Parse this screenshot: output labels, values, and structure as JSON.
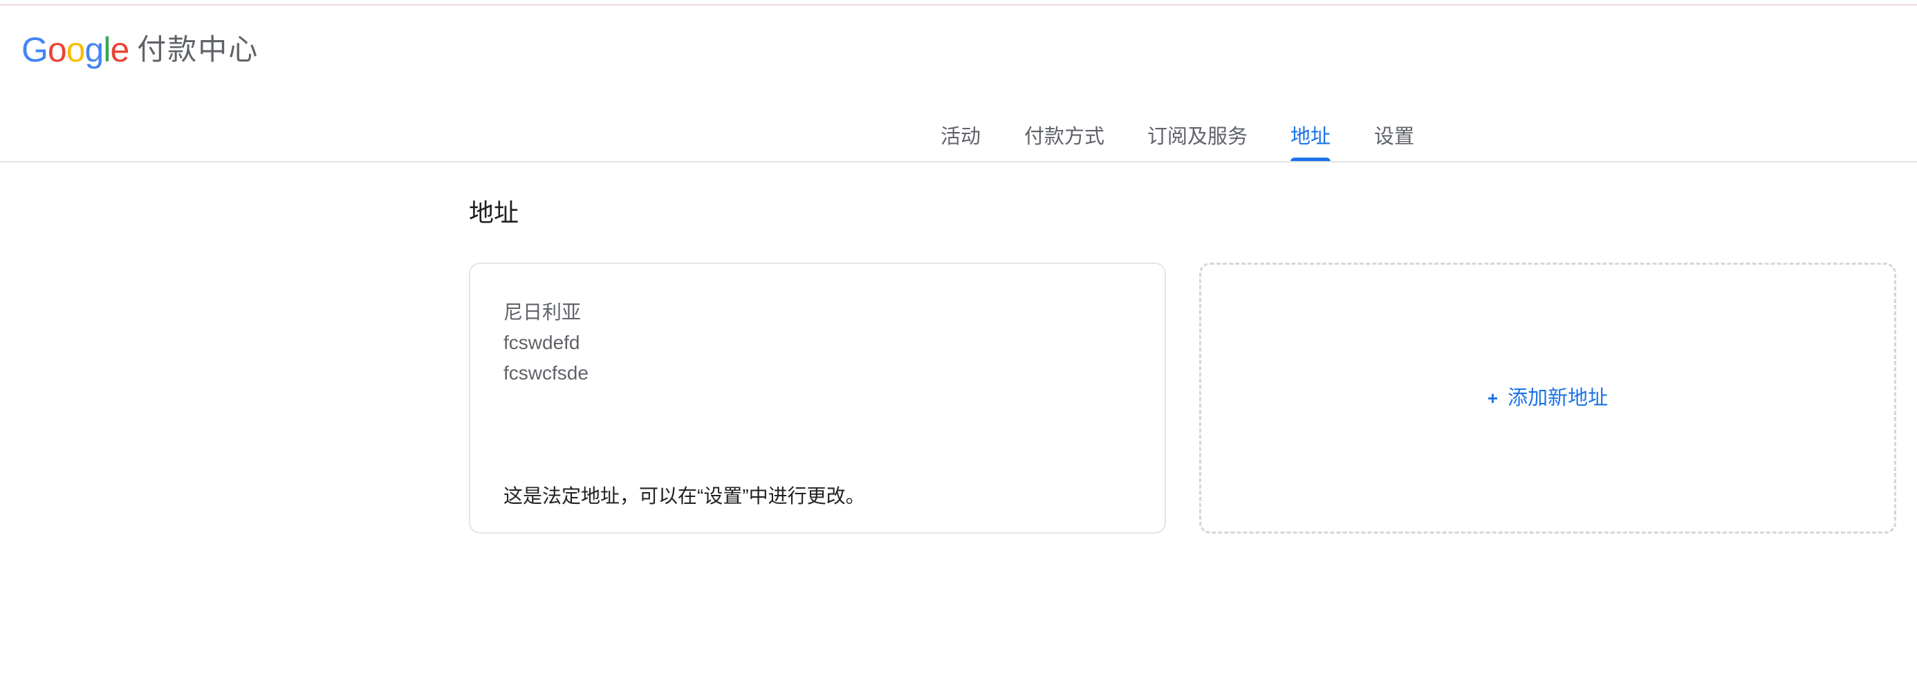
{
  "header": {
    "logo": {
      "letters": [
        {
          "char": "G",
          "color": "#4285F4"
        },
        {
          "char": "o",
          "color": "#EA4335"
        },
        {
          "char": "o",
          "color": "#FBBC05"
        },
        {
          "char": "g",
          "color": "#4285F4"
        },
        {
          "char": "l",
          "color": "#34A853"
        },
        {
          "char": "e",
          "color": "#EA4335"
        }
      ]
    },
    "title": "付款中心"
  },
  "tabs": [
    {
      "label": "活动",
      "active": false
    },
    {
      "label": "付款方式",
      "active": false
    },
    {
      "label": "订阅及服务",
      "active": false
    },
    {
      "label": "地址",
      "active": true
    },
    {
      "label": "设置",
      "active": false
    }
  ],
  "main": {
    "section_title": "地址",
    "address_card": {
      "lines": [
        "尼日利亚",
        "fcswdefd",
        "fcswcfsde"
      ],
      "note": "这是法定地址，可以在“设置”中进行更改。"
    },
    "add_card": {
      "icon": "plus-icon",
      "icon_glyph": "+",
      "label": "添加新地址"
    }
  },
  "colors": {
    "accent": "#1a73e8",
    "text_primary": "#202124",
    "text_secondary": "#5f6368",
    "divider": "#e0e3e7"
  }
}
